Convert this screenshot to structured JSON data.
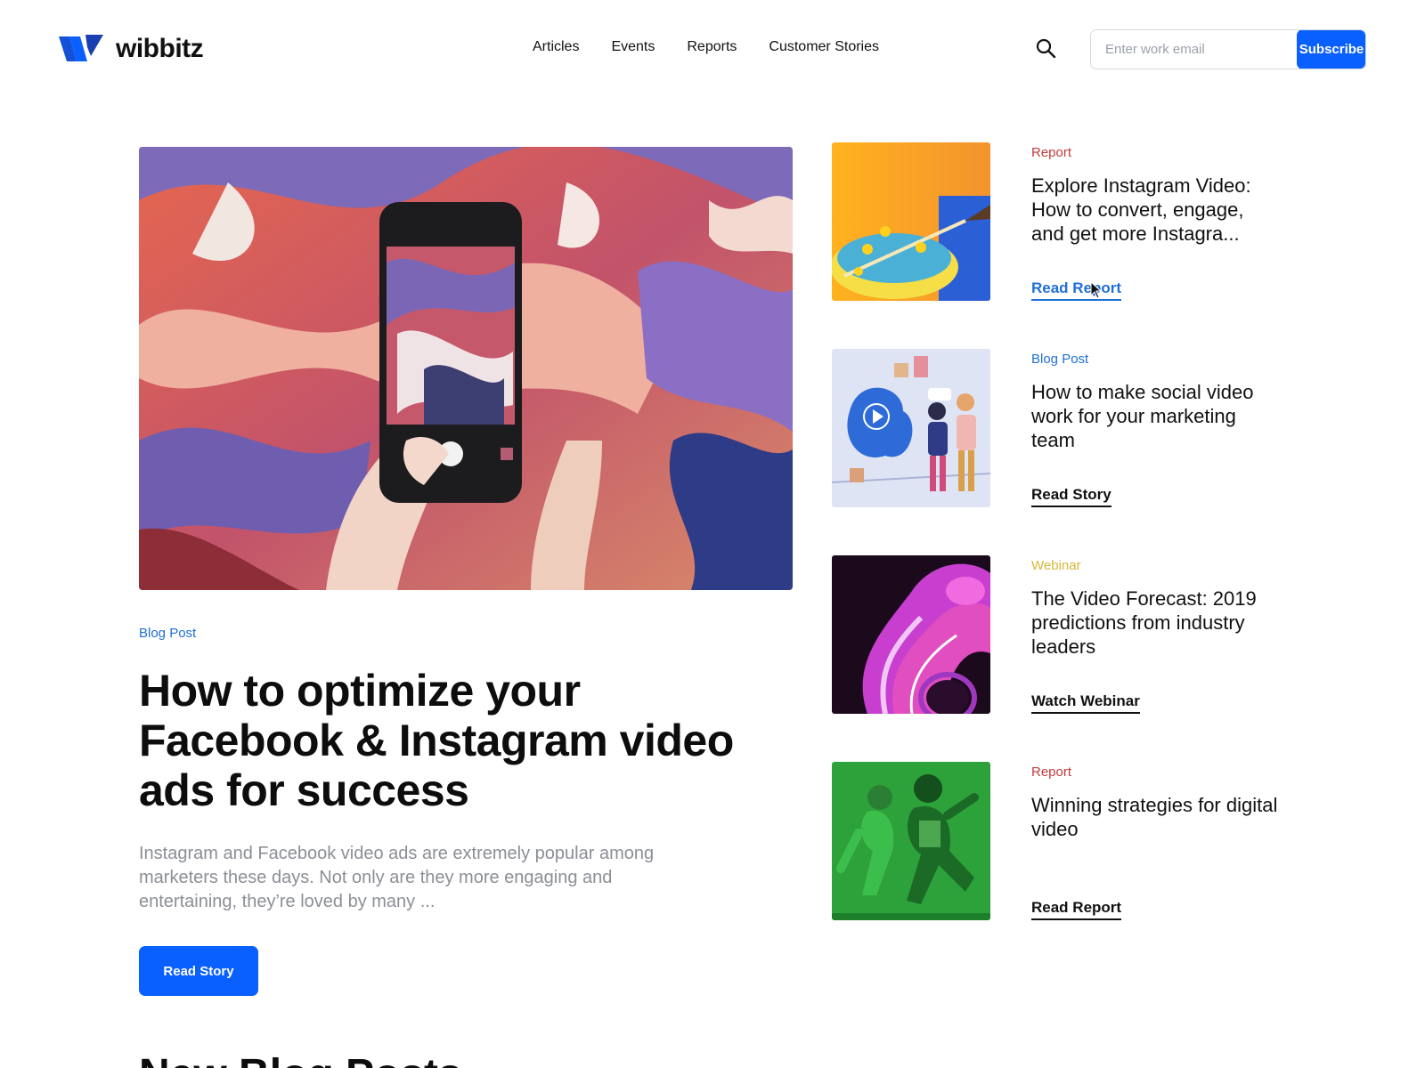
{
  "header": {
    "logo_text": "wibbitz",
    "nav": [
      "Articles",
      "Events",
      "Reports",
      "Customer Stories"
    ],
    "search_icon": "search-icon",
    "email_placeholder": "Enter work email",
    "subscribe_label": "Subscribe",
    "brand_color": "#0a5fff"
  },
  "featured": {
    "tag": "Blog Post",
    "title": "How to optimize your Facebook & Instagram video ads for success",
    "excerpt": "Instagram and Facebook video ads are extremely popular among marketers these days. Not only are they more engaging and entertaining, they’re loved by many ...",
    "cta": "Read Story"
  },
  "side_items": [
    {
      "tag": "Report",
      "title": "Explore Instagram Video: How to convert, engage, and get more Instagra...",
      "cta": "Read Report"
    },
    {
      "tag": "Blog Post",
      "title": "How to make social video work for your marketing team",
      "cta": "Read Story"
    },
    {
      "tag": "Webinar",
      "title": "The Video Forecast: 2019 predictions from industry leaders",
      "cta": "Watch Webinar"
    },
    {
      "tag": "Report",
      "title": "Winning strategies for digital video",
      "cta": "Read Report"
    }
  ],
  "section": {
    "title": "New Blog Posts"
  }
}
